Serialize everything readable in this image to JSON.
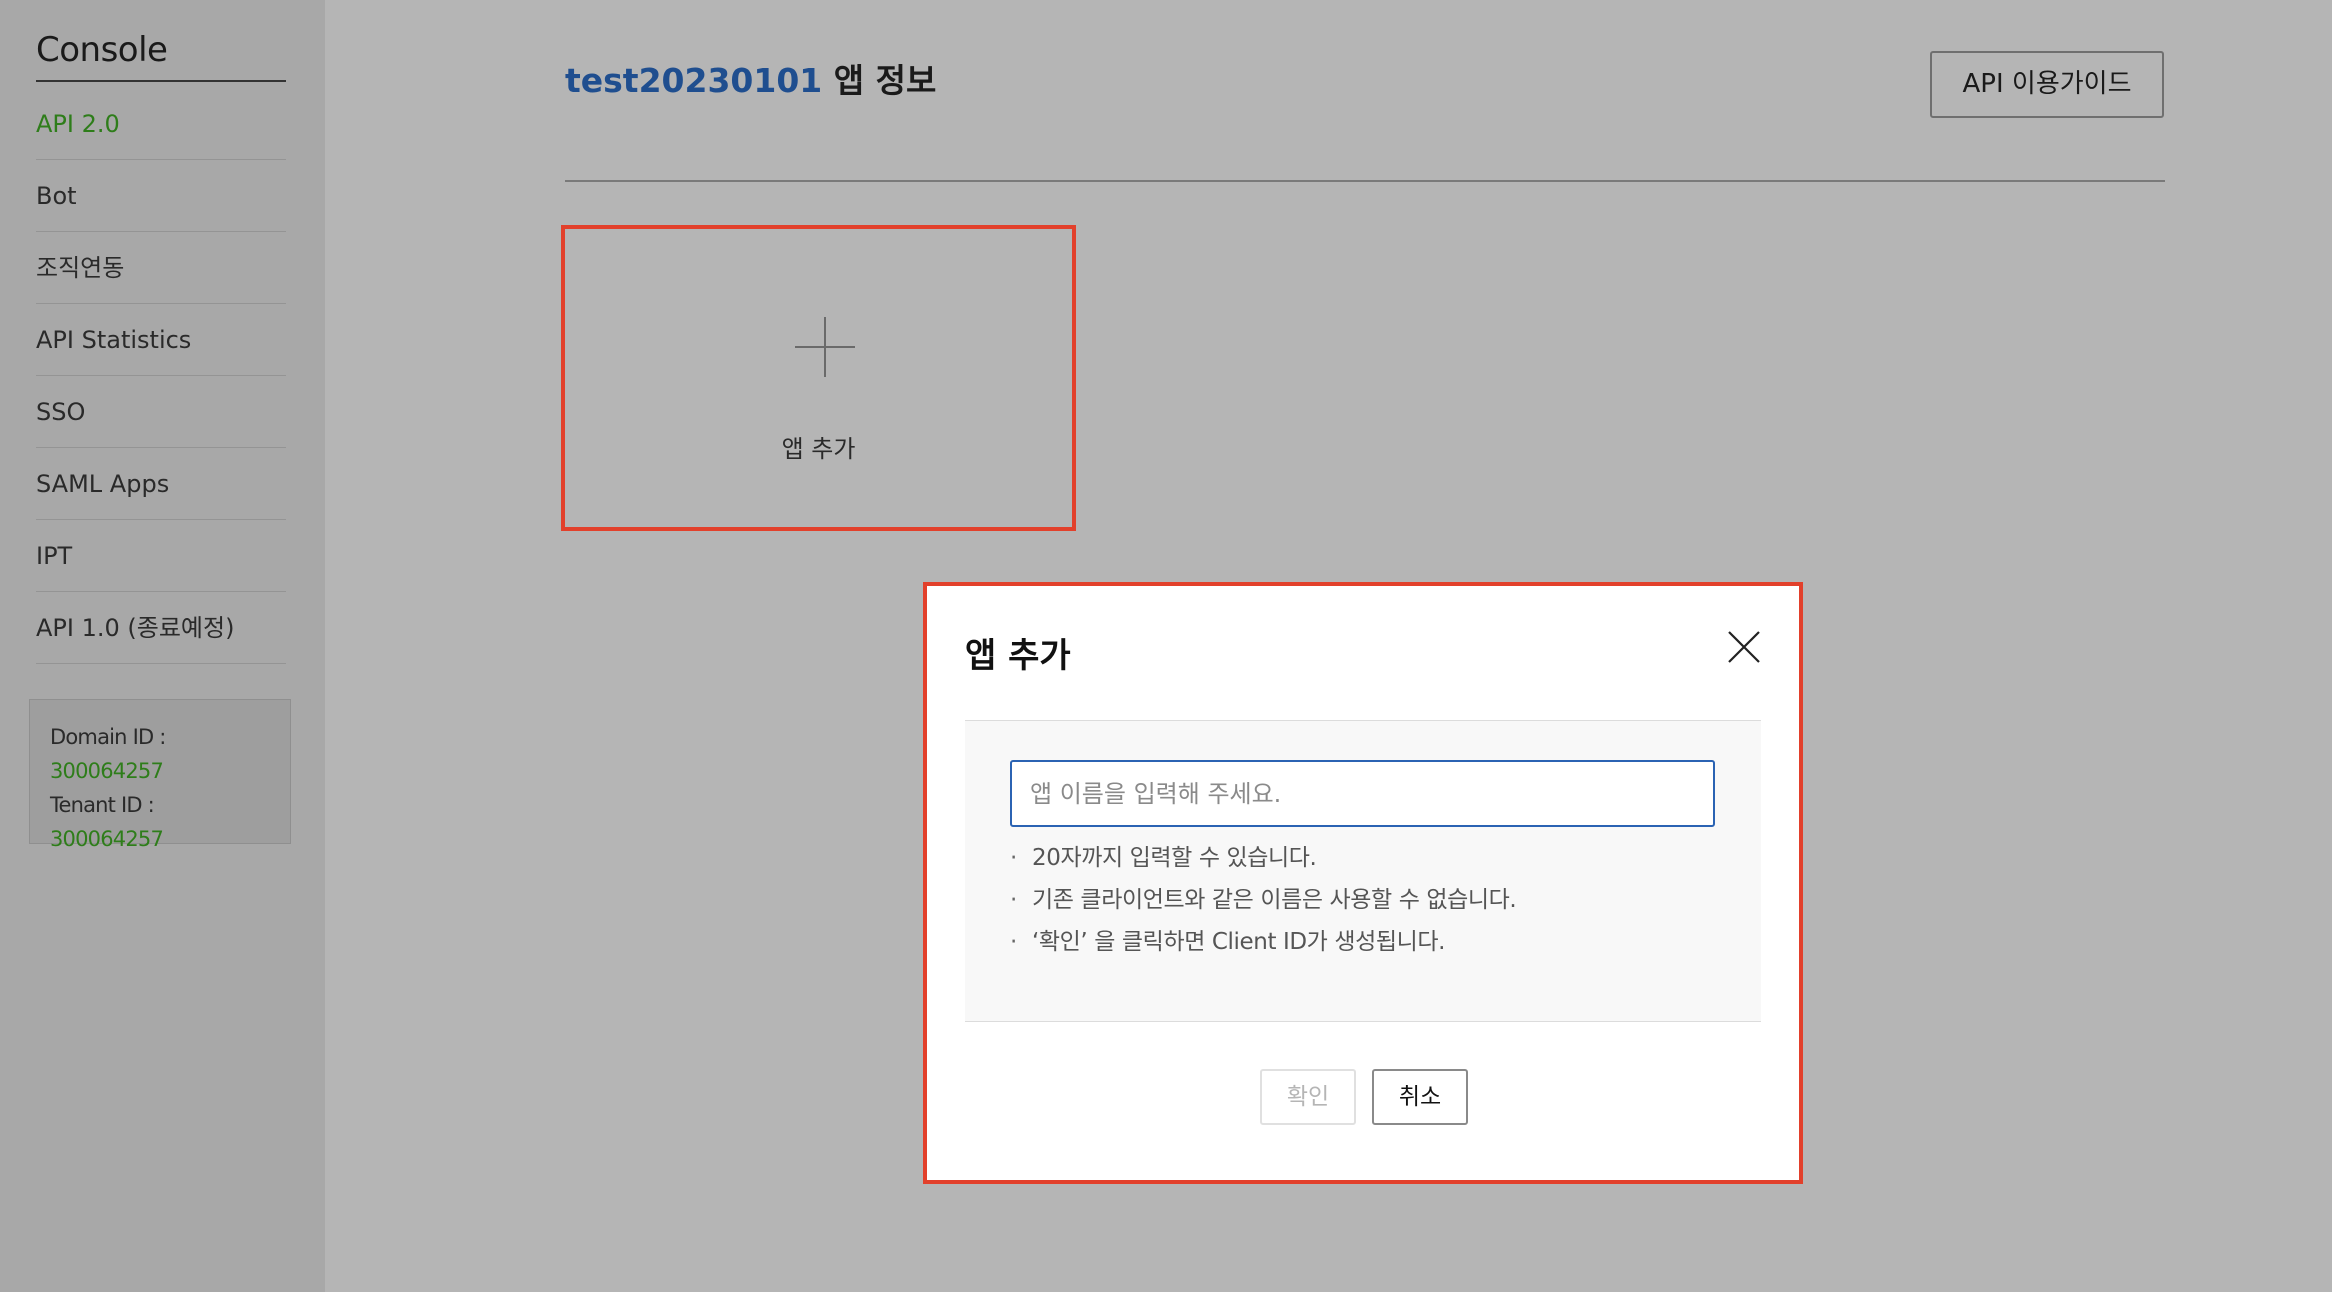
{
  "sidebar": {
    "title": "Console",
    "items": [
      {
        "label": "API 2.0"
      },
      {
        "label": "Bot"
      },
      {
        "label": "조직연동"
      },
      {
        "label": "API Statistics"
      },
      {
        "label": "SSO"
      },
      {
        "label": "SAML Apps"
      },
      {
        "label": "IPT"
      },
      {
        "label": "API 1.0 (종료예정)"
      }
    ],
    "info": {
      "domain_label": "Domain ID :",
      "domain_value": "300064257",
      "tenant_label": "Tenant ID :",
      "tenant_value": "300064257"
    }
  },
  "header": {
    "app_name": "test20230101",
    "title_suffix": " 앱 정보",
    "guide_button": "API 이용가이드"
  },
  "add_card": {
    "label": "앱 추가"
  },
  "dialog": {
    "title": "앱 추가",
    "input_placeholder": "앱 이름을 입력해 주세요.",
    "input_value": "",
    "notes": [
      "20자까지 입력할 수 있습니다.",
      "기존 클라이언트와 같은 이름은 사용할 수 없습니다.",
      "‘확인’ 을 클릭하면 Client ID가 생성됩니다."
    ],
    "bullet": "·",
    "confirm_label": "확인",
    "cancel_label": "취소"
  },
  "colors": {
    "accent_green": "#2e7d1a",
    "app_name_blue": "#1f4e8f",
    "highlight_red": "#e2402b",
    "input_border": "#2b63b3"
  }
}
